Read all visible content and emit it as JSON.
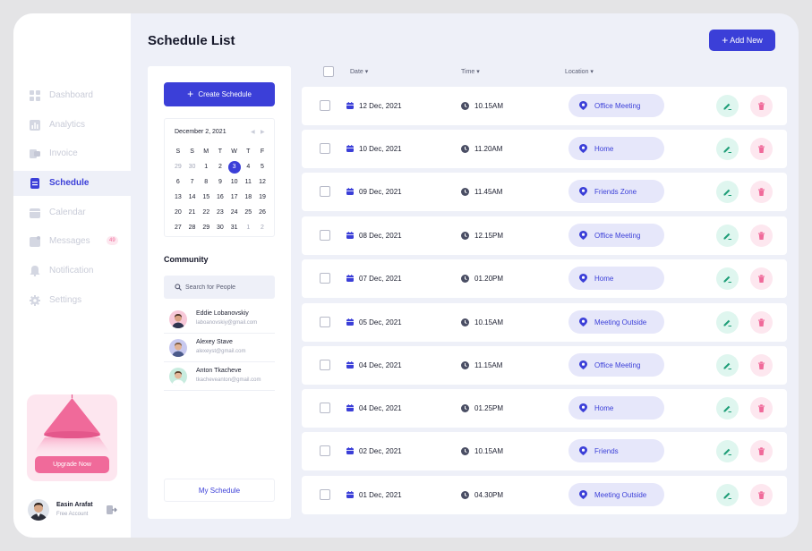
{
  "colors": {
    "accent": "#3b3fd8",
    "pink": "#f06a9a",
    "teal": "#1f9e78",
    "background": "#eef0f8"
  },
  "sidebar": {
    "items": [
      {
        "label": "Dashboard",
        "icon": "grid-icon"
      },
      {
        "label": "Analytics",
        "icon": "bar-chart-icon"
      },
      {
        "label": "Invoice",
        "icon": "invoice-icon"
      },
      {
        "label": "Schedule",
        "icon": "document-icon",
        "active": true
      },
      {
        "label": "Calendar",
        "icon": "calendar-icon"
      },
      {
        "label": "Messages",
        "icon": "message-icon",
        "badge": "49"
      },
      {
        "label": "Notification",
        "icon": "bell-icon"
      },
      {
        "label": "Settings",
        "icon": "gear-icon"
      }
    ],
    "upgrade_label": "Upgrade Now",
    "profile": {
      "name": "Easin Arafat",
      "subtitle": "Free Account"
    }
  },
  "header": {
    "title": "Schedule List",
    "add_label": "Add New"
  },
  "left_panel": {
    "create_label": "Create Schedule",
    "calendar": {
      "month_label": "December 2, 2021",
      "weekdays": [
        "S",
        "S",
        "M",
        "T",
        "W",
        "T",
        "F"
      ],
      "weeks": [
        [
          "29",
          "30",
          "1",
          "2",
          "3",
          "4",
          "5"
        ],
        [
          "6",
          "7",
          "8",
          "9",
          "10",
          "11",
          "12"
        ],
        [
          "13",
          "14",
          "15",
          "16",
          "17",
          "18",
          "19"
        ],
        [
          "20",
          "21",
          "22",
          "23",
          "24",
          "25",
          "26"
        ],
        [
          "27",
          "28",
          "29",
          "30",
          "31",
          "1",
          "2"
        ]
      ],
      "selected": "3"
    },
    "community_title": "Community",
    "search_placeholder": "Search for People",
    "people": [
      {
        "name": "Eddie Lobanovskiy",
        "email": "laboanovskiy@gmail.com"
      },
      {
        "name": "Alexey Stave",
        "email": "alexeyst@gmail.com"
      },
      {
        "name": "Anton Tkacheve",
        "email": "tkacheveanton@gmail.com"
      }
    ],
    "my_schedule_label": "My Schedule"
  },
  "table": {
    "headers": {
      "date": "Date",
      "time": "Time",
      "location": "Location"
    },
    "rows": [
      {
        "date": "12 Dec, 2021",
        "time": "10.15AM",
        "location": "Office Meeting"
      },
      {
        "date": "10 Dec, 2021",
        "time": "11.20AM",
        "location": "Home"
      },
      {
        "date": "09 Dec, 2021",
        "time": "11.45AM",
        "location": "Friends Zone"
      },
      {
        "date": "08 Dec, 2021",
        "time": "12.15PM",
        "location": "Office Meeting"
      },
      {
        "date": "07 Dec, 2021",
        "time": "01.20PM",
        "location": "Home"
      },
      {
        "date": "05 Dec, 2021",
        "time": "10.15AM",
        "location": "Meeting Outside"
      },
      {
        "date": "04 Dec, 2021",
        "time": "11.15AM",
        "location": "Office Meeting"
      },
      {
        "date": "04 Dec, 2021",
        "time": "01.25PM",
        "location": "Home"
      },
      {
        "date": "02 Dec, 2021",
        "time": "10.15AM",
        "location": "Friends"
      },
      {
        "date": "01 Dec, 2021",
        "time": "04.30PM",
        "location": "Meeting Outside"
      }
    ]
  }
}
